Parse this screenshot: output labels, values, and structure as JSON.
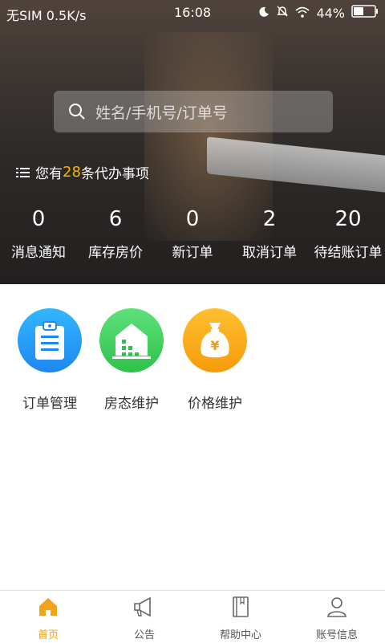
{
  "status_bar": {
    "carrier": "无SIM",
    "speed": "0.5K/s",
    "time": "16:08",
    "battery": "44%"
  },
  "search": {
    "placeholder": "姓名/手机号/订单号"
  },
  "todo": {
    "prefix": "您有",
    "count": "28",
    "suffix": "条代办事项"
  },
  "stats": [
    {
      "value": "0",
      "label": "消息通知"
    },
    {
      "value": "6",
      "label": "库存房价"
    },
    {
      "value": "0",
      "label": "新订单"
    },
    {
      "value": "2",
      "label": "取消订单"
    },
    {
      "value": "20",
      "label": "待结账订单"
    }
  ],
  "apps": [
    {
      "label": "订单管理",
      "icon": "clipboard-icon"
    },
    {
      "label": "房态维护",
      "icon": "house-icon"
    },
    {
      "label": "价格维护",
      "icon": "money-bag-icon"
    }
  ],
  "tabs": [
    {
      "label": "首页",
      "icon": "home-icon",
      "active": true
    },
    {
      "label": "公告",
      "icon": "megaphone-icon",
      "active": false
    },
    {
      "label": "帮助中心",
      "icon": "book-icon",
      "active": false
    },
    {
      "label": "账号信息",
      "icon": "user-icon",
      "active": false
    }
  ],
  "colors": {
    "accent": "#f2a31c",
    "count_highlight": "#f7b500"
  }
}
